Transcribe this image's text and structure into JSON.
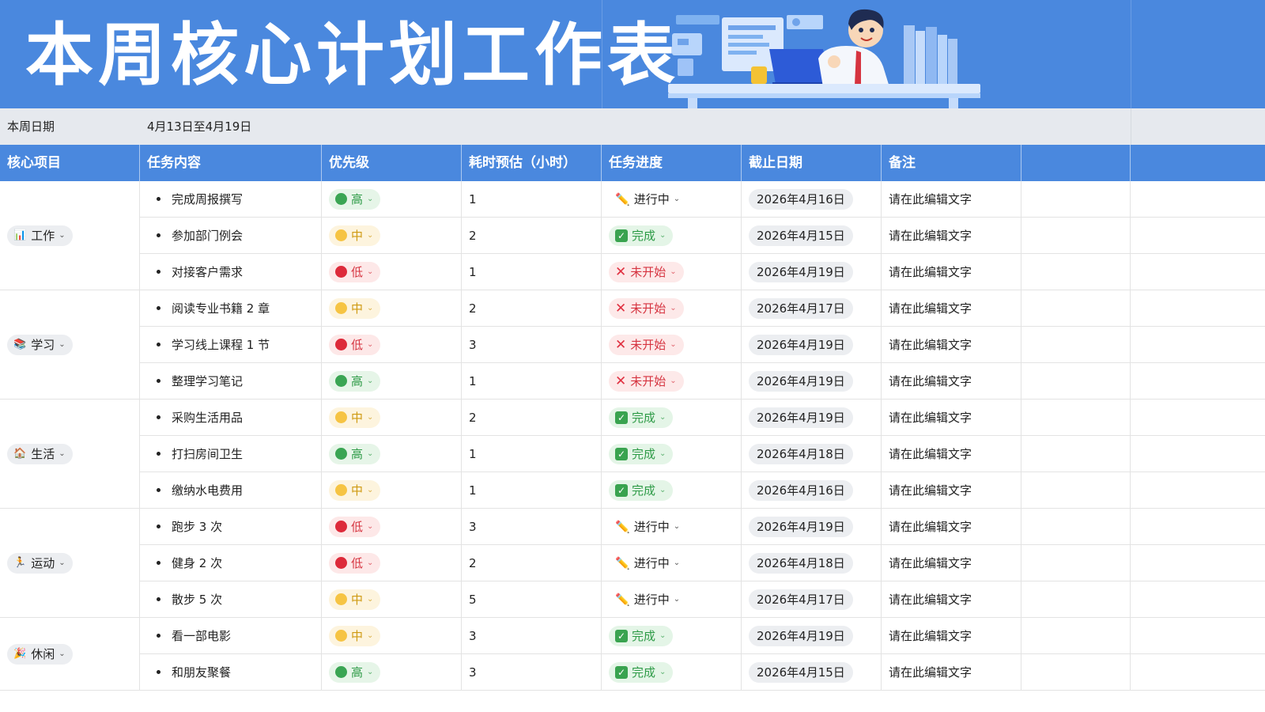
{
  "title": "本周核心计划工作表",
  "week": {
    "label": "本周日期",
    "value": "4月13日至4月19日"
  },
  "headers": [
    "核心项目",
    "任务内容",
    "优先级",
    "耗时预估（小时）",
    "任务进度",
    "截止日期",
    "备注"
  ],
  "colors": {
    "accent": "#4a88de",
    "high": "#3aa553",
    "mid": "#f6c443",
    "low": "#dd2a3a"
  },
  "categories": [
    {
      "label": "工作",
      "icon": "bar-chart-icon",
      "rows": 3
    },
    {
      "label": "学习",
      "icon": "books-icon",
      "rows": 3
    },
    {
      "label": "生活",
      "icon": "house-icon",
      "rows": 3
    },
    {
      "label": "运动",
      "icon": "runner-icon",
      "rows": 3
    },
    {
      "label": "休闲",
      "icon": "party-popper-icon",
      "rows": 2
    }
  ],
  "rows": [
    {
      "task": "完成周报撰写",
      "priority": "高",
      "priority_level": "high",
      "hours": "1",
      "status": "进行中",
      "status_type": "progress",
      "due": "2026年4月16日",
      "note": "请在此编辑文字"
    },
    {
      "task": "参加部门例会",
      "priority": "中",
      "priority_level": "mid",
      "hours": "2",
      "status": "完成",
      "status_type": "done",
      "due": "2026年4月15日",
      "note": "请在此编辑文字"
    },
    {
      "task": "对接客户需求",
      "priority": "低",
      "priority_level": "low",
      "hours": "1",
      "status": "未开始",
      "status_type": "none",
      "due": "2026年4月19日",
      "note": "请在此编辑文字"
    },
    {
      "task": "阅读专业书籍 2 章",
      "priority": "中",
      "priority_level": "mid",
      "hours": "2",
      "status": "未开始",
      "status_type": "none",
      "due": "2026年4月17日",
      "note": "请在此编辑文字"
    },
    {
      "task": "学习线上课程 1 节",
      "priority": "低",
      "priority_level": "low",
      "hours": "3",
      "status": "未开始",
      "status_type": "none",
      "due": "2026年4月19日",
      "note": "请在此编辑文字"
    },
    {
      "task": "整理学习笔记",
      "priority": "高",
      "priority_level": "high",
      "hours": "1",
      "status": "未开始",
      "status_type": "none",
      "due": "2026年4月19日",
      "note": "请在此编辑文字"
    },
    {
      "task": "采购生活用品",
      "priority": "中",
      "priority_level": "mid",
      "hours": "2",
      "status": "完成",
      "status_type": "done",
      "due": "2026年4月19日",
      "note": "请在此编辑文字"
    },
    {
      "task": "打扫房间卫生",
      "priority": "高",
      "priority_level": "high",
      "hours": "1",
      "status": "完成",
      "status_type": "done",
      "due": "2026年4月18日",
      "note": "请在此编辑文字"
    },
    {
      "task": "缴纳水电费用",
      "priority": "中",
      "priority_level": "mid",
      "hours": "1",
      "status": "完成",
      "status_type": "done",
      "due": "2026年4月16日",
      "note": "请在此编辑文字"
    },
    {
      "task": "跑步 3 次",
      "priority": "低",
      "priority_level": "low",
      "hours": "3",
      "status": "进行中",
      "status_type": "progress",
      "due": "2026年4月19日",
      "note": "请在此编辑文字"
    },
    {
      "task": "健身 2 次",
      "priority": "低",
      "priority_level": "low",
      "hours": "2",
      "status": "进行中",
      "status_type": "progress",
      "due": "2026年4月18日",
      "note": "请在此编辑文字"
    },
    {
      "task": "散步 5 次",
      "priority": "中",
      "priority_level": "mid",
      "hours": "5",
      "status": "进行中",
      "status_type": "progress",
      "due": "2026年4月17日",
      "note": "请在此编辑文字"
    },
    {
      "task": "看一部电影",
      "priority": "中",
      "priority_level": "mid",
      "hours": "3",
      "status": "完成",
      "status_type": "done",
      "due": "2026年4月19日",
      "note": "请在此编辑文字"
    },
    {
      "task": "和朋友聚餐",
      "priority": "高",
      "priority_level": "high",
      "hours": "3",
      "status": "完成",
      "status_type": "done",
      "due": "2026年4月15日",
      "note": "请在此编辑文字"
    }
  ]
}
